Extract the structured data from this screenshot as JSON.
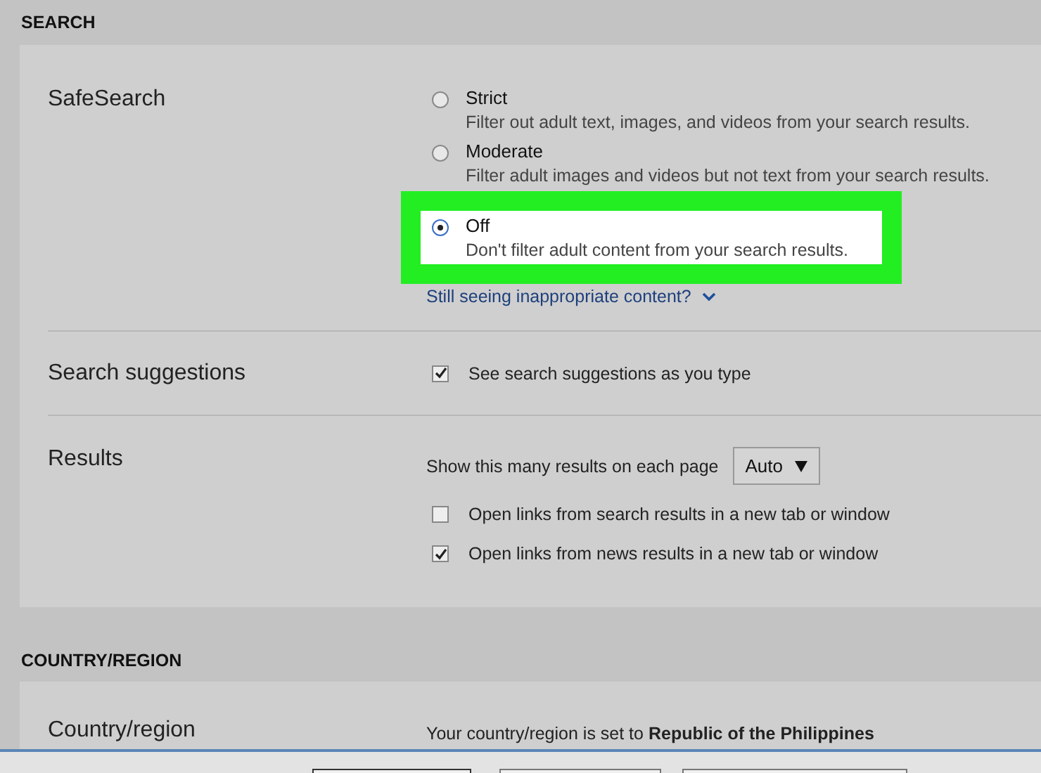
{
  "search": {
    "title": "SEARCH",
    "safesearch": {
      "label": "SafeSearch",
      "options": [
        {
          "label": "Strict",
          "description": "Filter out adult text, images, and videos from your search results.",
          "selected": false,
          "highlighted": false
        },
        {
          "label": "Moderate",
          "description": "Filter adult images and videos but not text from your search results.",
          "selected": false,
          "highlighted": false
        },
        {
          "label": "Off",
          "description": "Don't filter adult content from your search results.",
          "selected": true,
          "highlighted": true
        }
      ],
      "link": "Still seeing inappropriate content?"
    },
    "suggestions": {
      "label": "Search suggestions",
      "options": [
        {
          "label": "See search suggestions as you type",
          "checked": true
        }
      ]
    },
    "results": {
      "label": "Results",
      "count_label": "Show this many results on each page",
      "count_value": "Auto",
      "options": [
        {
          "label": "Open links from search results in a new tab or window",
          "checked": false
        },
        {
          "label": "Open links from news results in a new tab or window",
          "checked": true
        }
      ]
    }
  },
  "country": {
    "title": "COUNTRY/REGION",
    "label": "Country/region",
    "text": "Your country/region is set to **Republic of the Philippines**"
  }
}
